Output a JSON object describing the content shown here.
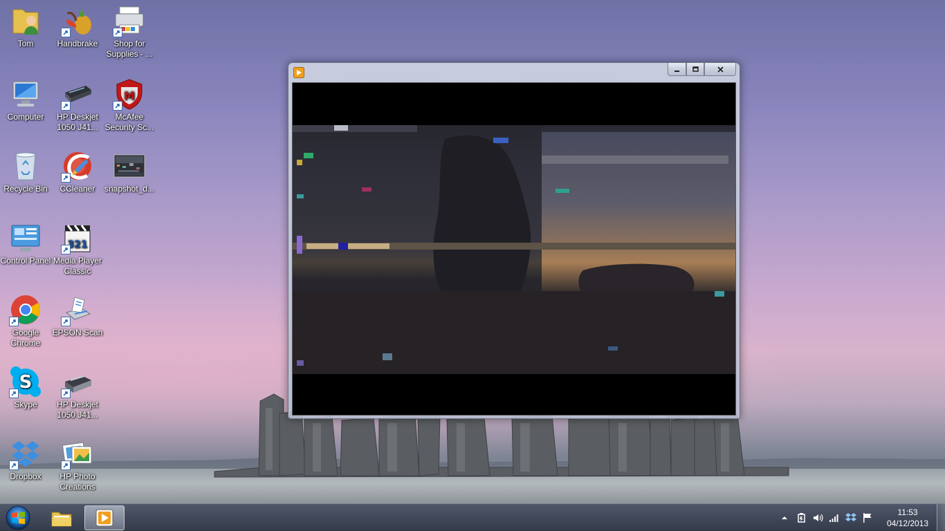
{
  "desktop": {
    "icons": [
      {
        "label": "Tom",
        "icon": "user-folder-icon"
      },
      {
        "label": "Handbrake",
        "icon": "handbrake-icon"
      },
      {
        "label": "Shop for Supplies - ...",
        "icon": "printer-shop-icon"
      },
      {
        "label": "Computer",
        "icon": "computer-icon"
      },
      {
        "label": "HP Deskjet 1050 J41...",
        "icon": "scanner-icon"
      },
      {
        "label": "McAfee Security Sc...",
        "icon": "mcafee-icon"
      },
      {
        "label": "Recycle Bin",
        "icon": "recycle-bin-icon"
      },
      {
        "label": "CCleaner",
        "icon": "ccleaner-icon"
      },
      {
        "label": "snapshot_d...",
        "icon": "image-file-icon"
      },
      {
        "label": "Control Panel",
        "icon": "control-panel-icon"
      },
      {
        "label": "Media Player Classic",
        "icon": "media-player-classic-icon"
      },
      {
        "label": "Google Chrome",
        "icon": "chrome-icon"
      },
      {
        "label": "EPSON Scan",
        "icon": "epson-scan-icon"
      },
      {
        "label": "Skype",
        "icon": "skype-icon"
      },
      {
        "label": "HP Deskjet 1050 J41...",
        "icon": "printer-icon"
      },
      {
        "label": "Dropbox",
        "icon": "dropbox-icon"
      },
      {
        "label": "HP Photo Creations",
        "icon": "photo-creations-icon"
      }
    ]
  },
  "window": {
    "app_icon": "media-player-icon",
    "controls": [
      "minimize",
      "maximize",
      "close"
    ]
  },
  "taskbar": {
    "start": "windows-start-icon",
    "pinned": [
      "file-explorer-icon",
      "media-player-icon"
    ],
    "tray_icons": [
      "show-hidden-icons",
      "power-icon",
      "volume-icon",
      "network-icon",
      "dropbox-icon",
      "action-center-flag-icon"
    ],
    "time": "11:53",
    "date": "04/12/2013"
  },
  "colors": {
    "taskbar": "#2e3446",
    "media_player_accent": "#f0a020",
    "chrome_red": "#db4437",
    "skype_blue": "#00aff0"
  }
}
